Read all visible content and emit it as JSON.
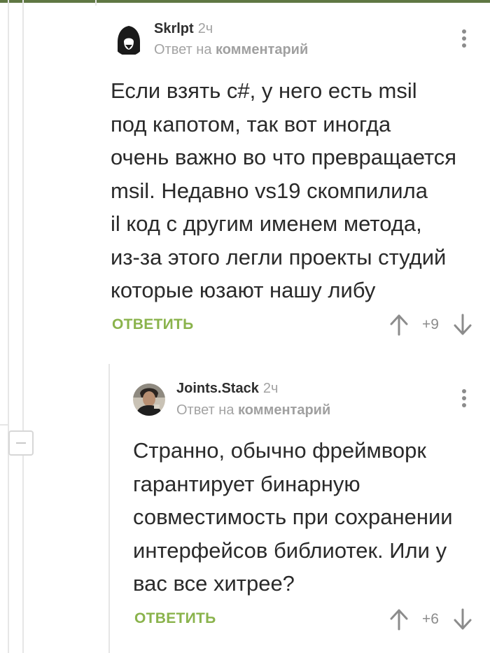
{
  "comments": [
    {
      "author": "Skrlpt",
      "time": "2ч",
      "reply_prefix": "Ответ на",
      "reply_link": "комментарий",
      "text": "Если взять c#, у него есть msil\nпод капотом, так вот иногда\nочень важно во что превращается\nmsil. Недавно vs19 скомпилила\nil код с другим именем метода,\nиз-за этого легли проекты студий\nкоторые юзают нашу либу",
      "reply_label": "ОТВЕТИТЬ",
      "score": "+9",
      "avatar_icon": "hooded-figure-icon"
    },
    {
      "author": "Joints.Stack",
      "time": "2ч",
      "reply_prefix": "Ответ на",
      "reply_link": "комментарий",
      "text": "Странно, обычно фреймворк\nгарантирует бинарную\nсовместимость при сохранении\nинтерфейсов библиотек. Или у\nвас все хитрее?",
      "reply_label": "ОТВЕТИТЬ",
      "score": "+6",
      "avatar_icon": "person-photo-icon"
    }
  ],
  "colors": {
    "accent_green": "#8ab34c",
    "top_bar": "#5f7743",
    "thread_line": "#e6e6e6",
    "muted_text": "#a3a3a3"
  }
}
